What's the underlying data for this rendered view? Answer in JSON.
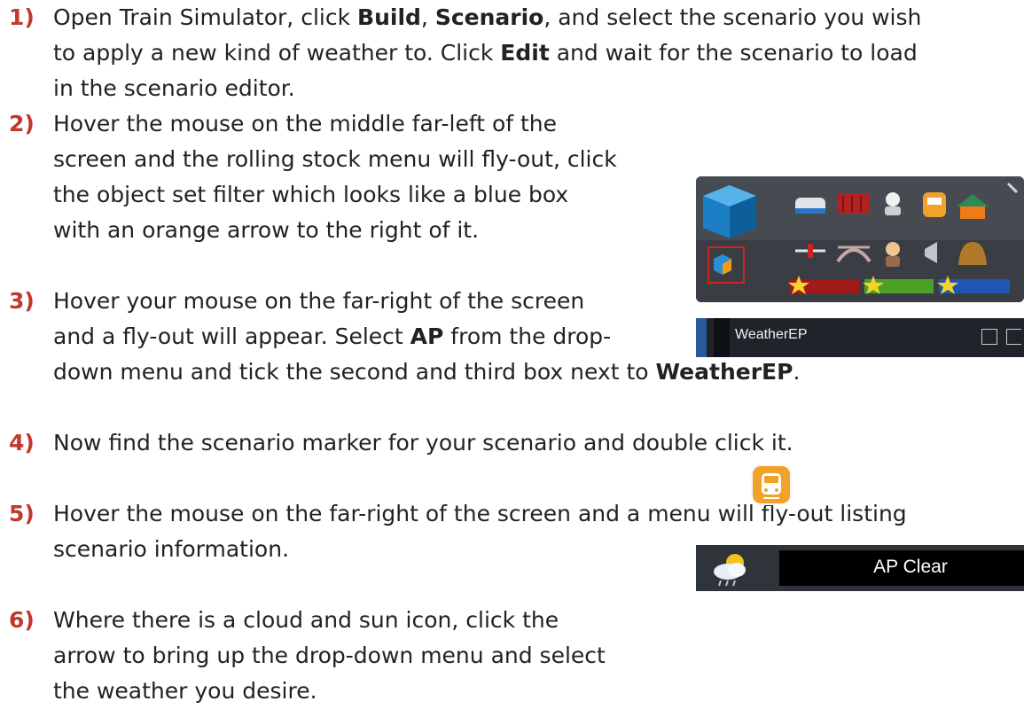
{
  "steps": [
    {
      "num": "1)",
      "lines": [
        [
          "Open Train Simulator, click ",
          {
            "b": "Build"
          },
          ", ",
          {
            "b": "Scenario"
          },
          ", and select the scenario you wish"
        ],
        [
          "to apply a new kind of weather to. Click ",
          {
            "b": "Edit"
          },
          " and wait for the scenario to load"
        ],
        [
          "in the scenario editor."
        ]
      ]
    },
    {
      "num": "2)",
      "lines": [
        [
          "Hover the mouse on the middle far-left of the"
        ],
        [
          "screen and the rolling stock menu will fly-out, click"
        ],
        [
          "the object set filter which looks like a blue box"
        ],
        [
          "with an orange arrow to the right of it."
        ]
      ]
    },
    {
      "num": "3)",
      "lines": [
        [
          "Hover your mouse on the far-right of the screen"
        ],
        [
          "and a fly-out will appear. Select ",
          {
            "b": "AP"
          },
          " from the drop-"
        ],
        [
          "down menu and tick the second and third box next to ",
          {
            "b": "WeatherEP"
          },
          "."
        ]
      ]
    },
    {
      "num": "4)",
      "lines": [
        [
          "Now find the scenario marker for your scenario and double click it."
        ]
      ]
    },
    {
      "num": "5)",
      "lines": [
        [
          "Hover the mouse on the far-right of the screen and a menu will fly-out listing"
        ],
        [
          "scenario information."
        ]
      ]
    },
    {
      "num": "6)",
      "lines": [
        [
          "Where there is a cloud and sun icon, click the"
        ],
        [
          "arrow to bring up the drop-down menu and select"
        ],
        [
          "the weather you desire."
        ]
      ]
    }
  ],
  "screens": {
    "filter_row_label": "WeatherEP",
    "weather_value": "AP Clear"
  }
}
